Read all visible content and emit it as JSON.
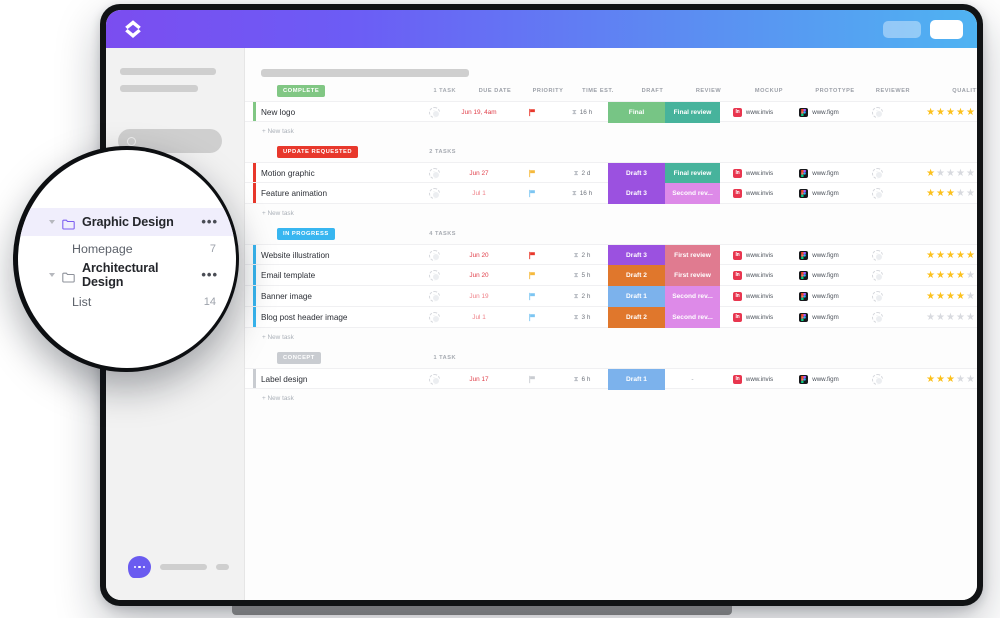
{
  "app": {
    "logo_icon": "clickup-chevrons-logo",
    "topbar_buttons": [
      {
        "name": "ghost-pill-button",
        "label": ""
      },
      {
        "name": "solid-pill-button",
        "label": ""
      }
    ],
    "accent_gradient_start": "#7b4df0",
    "accent_gradient_end": "#4fb3f2"
  },
  "sidebar": {
    "search_icon": "search-icon",
    "chat_icon": "chat-bubble-icon",
    "chat_color": "#6a5bf0"
  },
  "magnifier": {
    "items": [
      {
        "name": "sidebar-folder-graphic-design",
        "label": "Graphic Design",
        "icon": "folder-icon",
        "selected": true,
        "menu_icon": "more-options-icon",
        "children": [
          {
            "name": "sidebar-list-homepage",
            "label": "Homepage",
            "count": "7"
          }
        ]
      },
      {
        "name": "sidebar-folder-architectural-design",
        "label": "Architectural Design",
        "icon": "folder-icon",
        "selected": false,
        "menu_icon": "more-options-icon",
        "children": [
          {
            "name": "sidebar-list-list",
            "label": "List",
            "count": "14"
          }
        ]
      }
    ]
  },
  "table": {
    "columns": [
      {
        "key": "name",
        "label": ""
      },
      {
        "key": "due_date",
        "label": "DUE DATE"
      },
      {
        "key": "priority",
        "label": "PRIORITY"
      },
      {
        "key": "time_est",
        "label": "TIME EST."
      },
      {
        "key": "draft",
        "label": "DRAFT"
      },
      {
        "key": "review",
        "label": "REVIEW"
      },
      {
        "key": "mockup",
        "label": "MOCKUP"
      },
      {
        "key": "prototype",
        "label": "PROTOTYPE"
      },
      {
        "key": "reviewer",
        "label": "REVIEWER"
      },
      {
        "key": "quality",
        "label": "QUALITY"
      }
    ],
    "new_task_label": "+ New task",
    "sections": [
      {
        "name": "status-group-complete",
        "status": "COMPLETE",
        "status_color": "#81c784",
        "count_label": "1 TASK",
        "tasks": [
          {
            "name": "New logo",
            "due_date": "Jun 19, 4am",
            "due_urgent": true,
            "priority": "red",
            "time_est": "16 h",
            "draft": {
              "label": "Final",
              "color": "#77c585"
            },
            "review": {
              "label": "Final review",
              "color": "#47b39c"
            },
            "mockup": "www.invis",
            "prototype": "www.figm",
            "reviewer": "",
            "quality": 5
          }
        ]
      },
      {
        "name": "status-group-update-requested",
        "status": "UPDATE REQUESTED",
        "status_color": "#e8382c",
        "count_label": "2 TASKS",
        "tasks": [
          {
            "name": "Motion graphic",
            "due_date": "Jun 27",
            "due_urgent": true,
            "priority": "yellow",
            "time_est": "2 d",
            "draft": {
              "label": "Draft 3",
              "color": "#9b51e0"
            },
            "review": {
              "label": "Final review",
              "color": "#47b39c"
            },
            "mockup": "www.invis",
            "prototype": "www.figm",
            "reviewer": "",
            "quality": 1
          },
          {
            "name": "Feature animation",
            "due_date": "Jul 1",
            "due_urgent": false,
            "priority": "blue",
            "time_est": "16 h",
            "draft": {
              "label": "Draft 3",
              "color": "#9b51e0"
            },
            "review": {
              "label": "Second rev...",
              "color": "#dd8ae8"
            },
            "mockup": "www.invis",
            "prototype": "www.figm",
            "reviewer": "",
            "quality": 3
          }
        ]
      },
      {
        "name": "status-group-in-progress",
        "status": "IN PROGRESS",
        "status_color": "#38b6f0",
        "count_label": "4 TASKS",
        "tasks": [
          {
            "name": "Website illustration",
            "due_date": "Jun 20",
            "due_urgent": true,
            "priority": "red",
            "time_est": "2 h",
            "draft": {
              "label": "Draft 3",
              "color": "#9b51e0"
            },
            "review": {
              "label": "First review",
              "color": "#e07b90"
            },
            "mockup": "www.invis",
            "prototype": "www.figm",
            "reviewer": "",
            "quality": 5
          },
          {
            "name": "Email template",
            "due_date": "Jun 20",
            "due_urgent": true,
            "priority": "yellow",
            "time_est": "5 h",
            "draft": {
              "label": "Draft 2",
              "color": "#e0772c"
            },
            "review": {
              "label": "First review",
              "color": "#e07b90"
            },
            "mockup": "www.invis",
            "prototype": "www.figm",
            "reviewer": "",
            "quality": 4
          },
          {
            "name": "Banner image",
            "due_date": "Jun 19",
            "due_urgent": false,
            "priority": "blue",
            "time_est": "2 h",
            "draft": {
              "label": "Draft 1",
              "color": "#7cb2ec"
            },
            "review": {
              "label": "Second rev...",
              "color": "#dd8ae8"
            },
            "mockup": "www.invis",
            "prototype": "www.figm",
            "reviewer": "",
            "quality": 4
          },
          {
            "name": "Blog post header image",
            "due_date": "Jul 1",
            "due_urgent": false,
            "priority": "blue",
            "time_est": "3 h",
            "draft": {
              "label": "Draft 2",
              "color": "#e0772c"
            },
            "review": {
              "label": "Second rev...",
              "color": "#dd8ae8"
            },
            "mockup": "www.invis",
            "prototype": "www.figm",
            "reviewer": "",
            "quality": 0
          }
        ]
      },
      {
        "name": "status-group-concept",
        "status": "CONCEPT",
        "status_color": "#c9ccd1",
        "count_label": "1 TASK",
        "tasks": [
          {
            "name": "Label design",
            "due_date": "Jun 17",
            "due_urgent": true,
            "priority": "grey",
            "time_est": "6 h",
            "draft": {
              "label": "Draft 1",
              "color": "#7cb2ec"
            },
            "review": {
              "label": "-",
              "color": ""
            },
            "mockup": "www.invis",
            "prototype": "www.figm",
            "reviewer": "",
            "quality": 3
          }
        ]
      }
    ]
  }
}
